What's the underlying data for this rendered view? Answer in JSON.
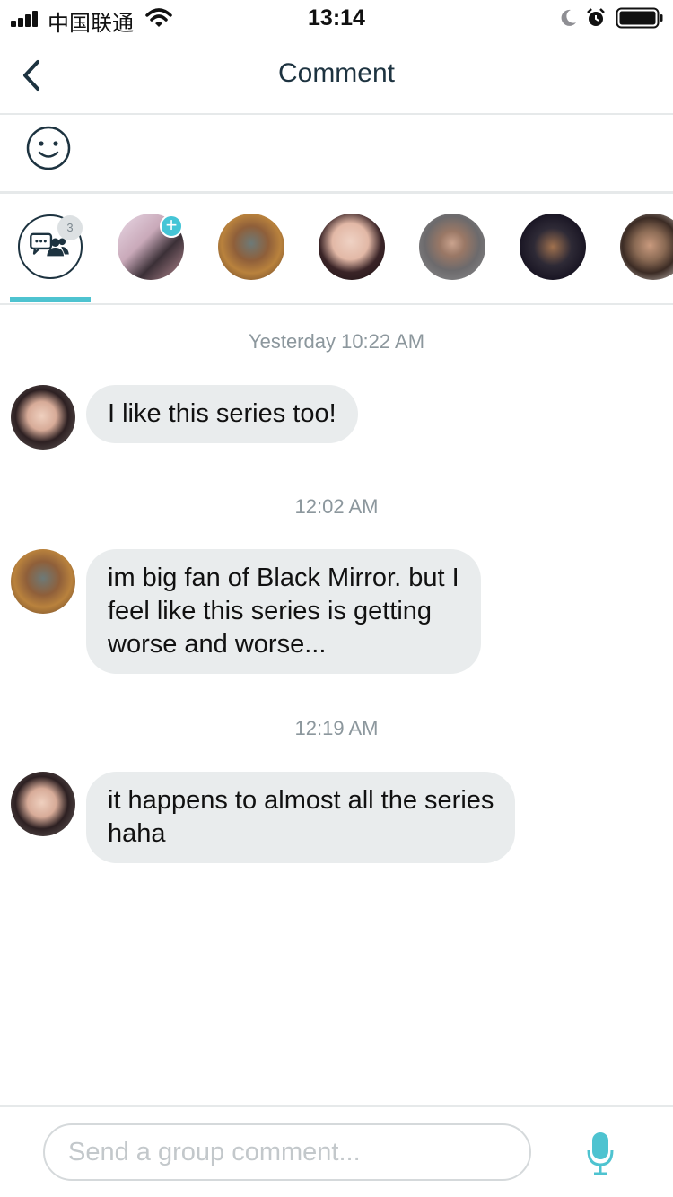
{
  "status_bar": {
    "carrier": "中国联通",
    "time": "13:14"
  },
  "header": {
    "title": "Comment"
  },
  "participants": {
    "group_count": "3",
    "avatar_count": 6,
    "add_badge": "+"
  },
  "messages": [
    {
      "timestamp": "Yesterday 10:22 AM",
      "lines": [
        "I like this series too!"
      ]
    },
    {
      "timestamp": "12:02 AM",
      "lines": [
        "im big fan of Black Mirror. but I",
        "feel like this series is getting",
        "worse and worse..."
      ]
    },
    {
      "timestamp": "12:19 AM",
      "lines": [
        "it happens to almost all the series",
        "haha"
      ]
    }
  ],
  "composer": {
    "placeholder": "Send a group comment..."
  },
  "colors": {
    "accent": "#4ec3d0",
    "bubble": "#e9eced",
    "title": "#1d3340",
    "timestamp": "#8c979d"
  }
}
